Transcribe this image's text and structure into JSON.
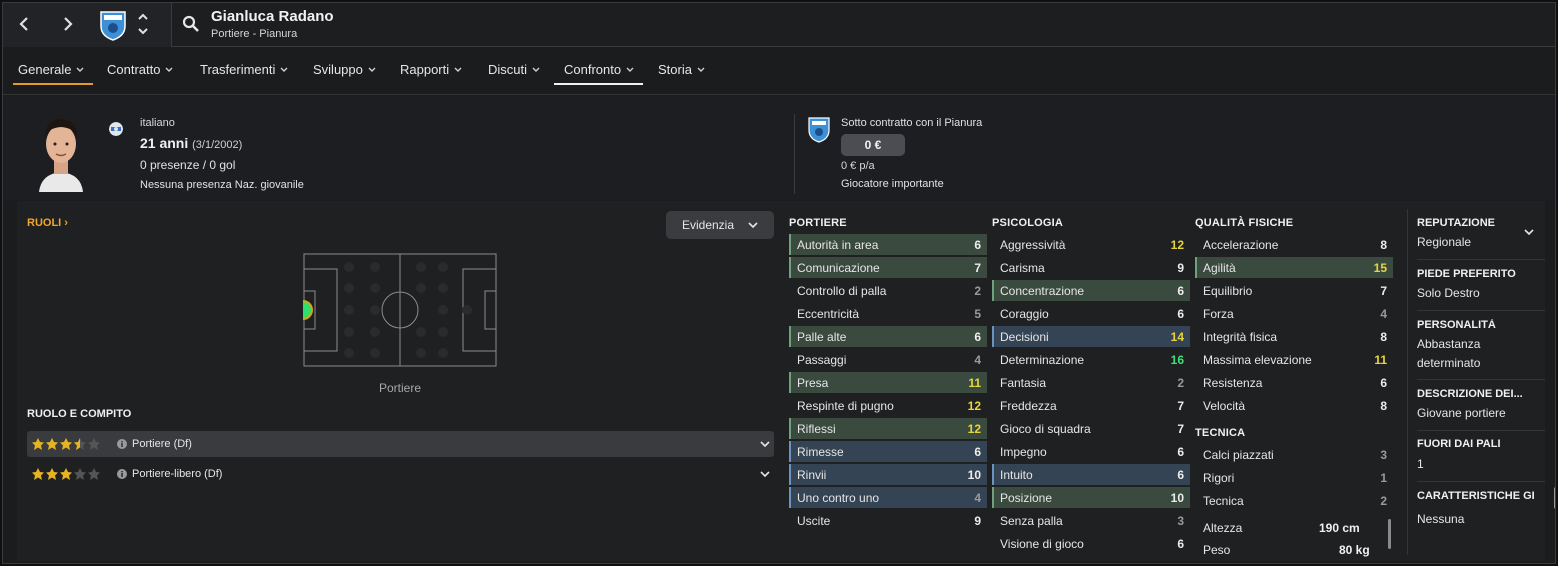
{
  "player": {
    "name": "Gianluca Radano",
    "subtitle": "Portiere - Pianura",
    "nationality": "italiano",
    "age": "21 anni",
    "birth": "(3/1/2002)",
    "appearances": "0 presenze / 0 gol",
    "youth_caps": "Nessuna presenza Naz. giovanile"
  },
  "contract": {
    "text": "Sotto contratto con il Pianura",
    "wage": "0 €",
    "wage_pa": "0 € p/a",
    "status": "Giocatore importante"
  },
  "tabs": [
    {
      "label": "Generale",
      "active": true
    },
    {
      "label": "Contratto"
    },
    {
      "label": "Trasferimenti"
    },
    {
      "label": "Sviluppo"
    },
    {
      "label": "Rapporti"
    },
    {
      "label": "Discuti"
    },
    {
      "label": "Confronto",
      "selected": true
    },
    {
      "label": "Storia"
    }
  ],
  "roles": {
    "title": "RUOLI",
    "highlight_label": "Evidenzia",
    "pitch_label": "Portiere",
    "role_title": "RUOLO E COMPITO",
    "list": [
      {
        "name": "Portiere (Df)",
        "stars": 3.5
      },
      {
        "name": "Portiere-libero (Df)",
        "stars": 3
      }
    ]
  },
  "attributes": {
    "goalkeeping": {
      "title": "PORTIERE",
      "items": [
        {
          "name": "Autorità in area",
          "value": 6,
          "hl": "g"
        },
        {
          "name": "Comunicazione",
          "value": 7,
          "hl": "g"
        },
        {
          "name": "Controllo di palla",
          "value": 2
        },
        {
          "name": "Eccentricità",
          "value": 5
        },
        {
          "name": "Palle alte",
          "value": 6,
          "hl": "g"
        },
        {
          "name": "Passaggi",
          "value": 4
        },
        {
          "name": "Presa",
          "value": 11,
          "hl": "g"
        },
        {
          "name": "Respinte di pugno",
          "value": 12
        },
        {
          "name": "Riflessi",
          "value": 12,
          "hl": "g"
        },
        {
          "name": "Rimesse",
          "value": 6,
          "hl": "b"
        },
        {
          "name": "Rinvii",
          "value": 10,
          "hl": "b"
        },
        {
          "name": "Uno contro uno",
          "value": 4,
          "hl": "b"
        },
        {
          "name": "Uscite",
          "value": 9
        }
      ]
    },
    "mental": {
      "title": "PSICOLOGIA",
      "items": [
        {
          "name": "Aggressività",
          "value": 12
        },
        {
          "name": "Carisma",
          "value": 9
        },
        {
          "name": "Concentrazione",
          "value": 6,
          "hl": "g"
        },
        {
          "name": "Coraggio",
          "value": 6
        },
        {
          "name": "Decisioni",
          "value": 14,
          "hl": "b"
        },
        {
          "name": "Determinazione",
          "value": 16
        },
        {
          "name": "Fantasia",
          "value": 2
        },
        {
          "name": "Freddezza",
          "value": 7
        },
        {
          "name": "Gioco di squadra",
          "value": 7
        },
        {
          "name": "Impegno",
          "value": 6
        },
        {
          "name": "Intuito",
          "value": 6,
          "hl": "b"
        },
        {
          "name": "Posizione",
          "value": 10,
          "hl": "g"
        },
        {
          "name": "Senza palla",
          "value": 3
        },
        {
          "name": "Visione di gioco",
          "value": 6
        }
      ]
    },
    "physical": {
      "title": "QUALITÀ FISICHE",
      "items": [
        {
          "name": "Accelerazione",
          "value": 8
        },
        {
          "name": "Agilità",
          "value": 15,
          "hl": "g"
        },
        {
          "name": "Equilibrio",
          "value": 7
        },
        {
          "name": "Forza",
          "value": 4
        },
        {
          "name": "Integrità fisica",
          "value": 8
        },
        {
          "name": "Massima elevazione",
          "value": 11
        },
        {
          "name": "Resistenza",
          "value": 6
        },
        {
          "name": "Velocità",
          "value": 8
        }
      ]
    },
    "technical": {
      "title": "TECNICA",
      "items": [
        {
          "name": "Calci piazzati",
          "value": 3
        },
        {
          "name": "Rigori",
          "value": 1
        },
        {
          "name": "Tecnica",
          "value": 2
        }
      ]
    },
    "height_label": "Altezza",
    "height": "190 cm",
    "weight_label": "Peso",
    "weight": "80 kg"
  },
  "info": [
    {
      "title": "REPUTAZIONE",
      "value": "Regionale"
    },
    {
      "title": "PIEDE PREFERITO",
      "value": "Solo Destro"
    },
    {
      "title": "PERSONALITÀ",
      "value": "Abbastanza determinato"
    },
    {
      "title": "DESCRIZIONE DEI...",
      "value": "Giovane portiere"
    },
    {
      "title": "FUORI DAI PALI",
      "value": "1"
    },
    {
      "title": "CARATTERISTICHE GI",
      "value": "Nessuna"
    }
  ],
  "colors": {
    "accent_orange": "#f0a62a",
    "tab_underline_orange": "#e8982a",
    "tab_underline_white": "#f0f0f0",
    "value_high": "#e8d63a",
    "value_top": "#3ee07a",
    "position_dot": "#2ee06a"
  }
}
